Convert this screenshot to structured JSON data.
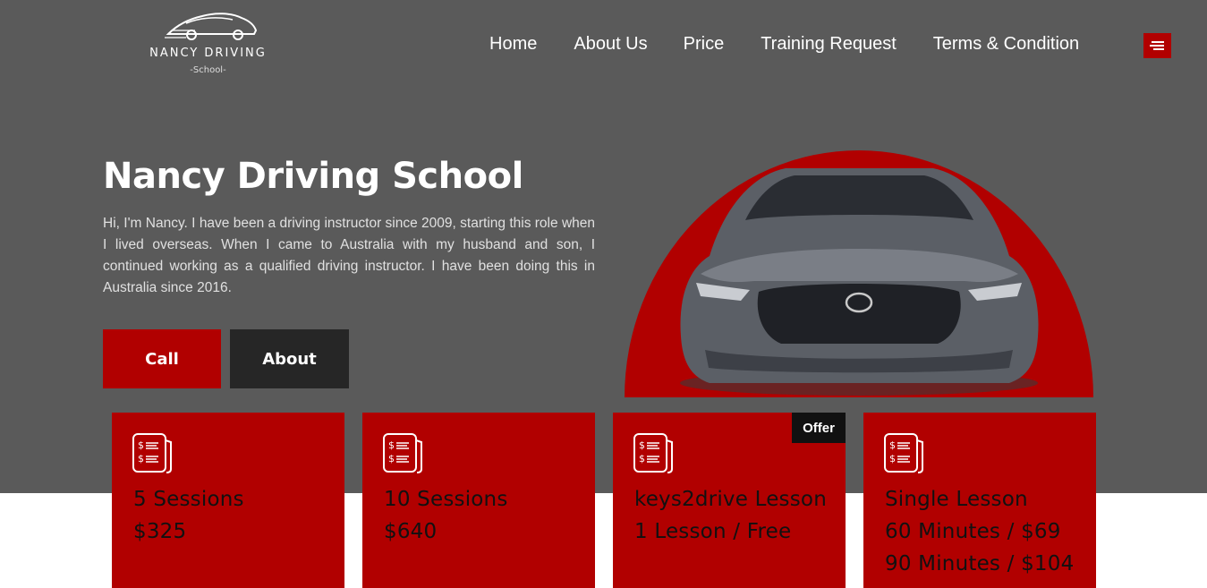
{
  "brand": {
    "name": "NANCY DRIVING",
    "sub": "-School-"
  },
  "nav": {
    "items": [
      "Home",
      "About Us",
      "Price",
      "Training Request",
      "Terms & Condition"
    ],
    "menu_icon": "hamburger-menu-icon"
  },
  "hero": {
    "title": "Nancy Driving School",
    "text": "Hi, I'm Nancy. I have been a driving instructor since 2009, starting this role when I lived overseas. When I came to Australia with my husband and son, I continued working as a qualified driving instructor. I have been doing this in Australia since 2016.",
    "call_label": "Call",
    "about_label": "About"
  },
  "cards": [
    {
      "lines": [
        "5 Sessions",
        "$325"
      ],
      "badge": ""
    },
    {
      "lines": [
        "10 Sessions",
        "$640"
      ],
      "badge": ""
    },
    {
      "lines": [
        "keys2drive Lesson",
        "1 Lesson / Free"
      ],
      "badge": "Offer"
    },
    {
      "lines": [
        "Single Lesson",
        "60 Minutes / $69",
        "90 Minutes / $104"
      ],
      "badge": ""
    }
  ],
  "colors": {
    "accent": "#b10000",
    "hero_bg": "#5a5a5a",
    "dark": "#262626"
  }
}
